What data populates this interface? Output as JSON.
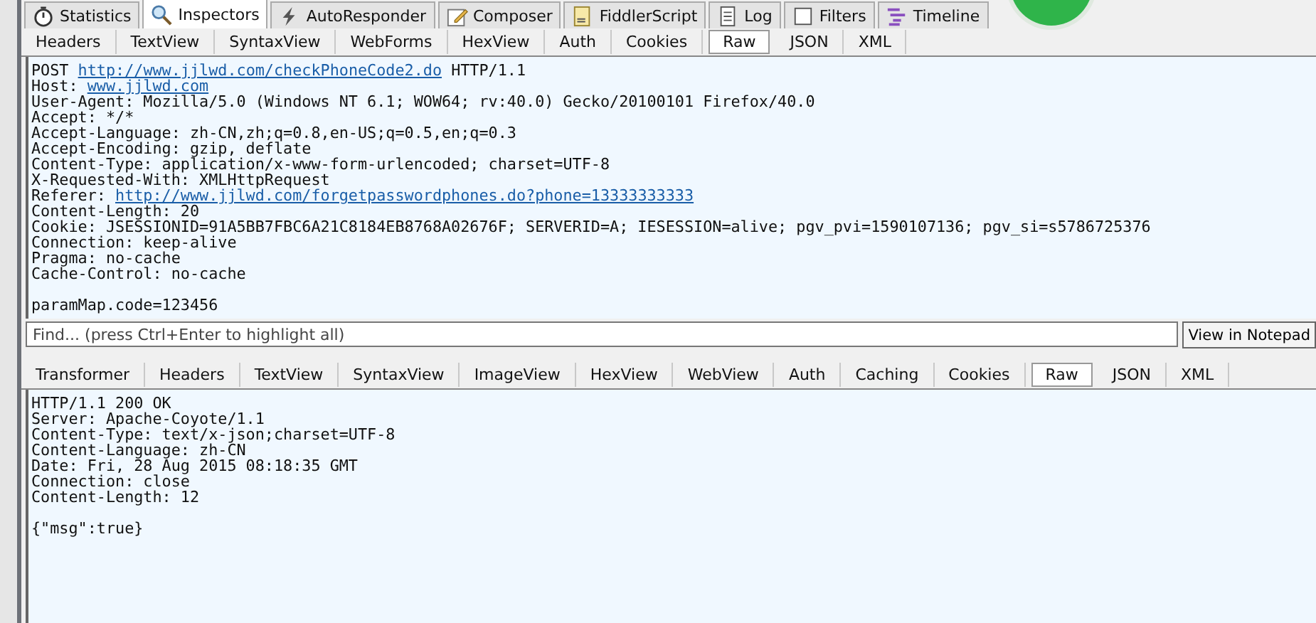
{
  "main_tabs": [
    {
      "label": "Statistics",
      "kind": "stopwatch",
      "selected": false
    },
    {
      "label": "Inspectors",
      "kind": "magnifier",
      "selected": true
    },
    {
      "label": "AutoResponder",
      "kind": "bolt",
      "selected": false
    },
    {
      "label": "Composer",
      "kind": "pencil",
      "selected": false
    },
    {
      "label": "FiddlerScript",
      "kind": "script",
      "selected": false
    },
    {
      "label": "Log",
      "kind": "document",
      "selected": false
    },
    {
      "label": "Filters",
      "kind": "checkbox",
      "selected": false
    },
    {
      "label": "Timeline",
      "kind": "timeline",
      "selected": false
    }
  ],
  "request": {
    "tabs": [
      {
        "label": "Headers",
        "selected": false
      },
      {
        "label": "TextView",
        "selected": false
      },
      {
        "label": "SyntaxView",
        "selected": false
      },
      {
        "label": "WebForms",
        "selected": false
      },
      {
        "label": "HexView",
        "selected": false
      },
      {
        "label": "Auth",
        "selected": false
      },
      {
        "label": "Cookies",
        "selected": false
      },
      {
        "label": "Raw",
        "selected": true
      },
      {
        "label": "JSON",
        "selected": false
      },
      {
        "label": "XML",
        "selected": false
      }
    ],
    "lines": [
      {
        "blank_before": false,
        "parts": [
          {
            "kind": "plain",
            "text": "POST "
          },
          {
            "kind": "link",
            "text": "http://www.jjlwd.com/checkPhoneCode2.do"
          },
          {
            "kind": "plain",
            "text": " HTTP/1.1"
          }
        ]
      },
      {
        "blank_before": false,
        "parts": [
          {
            "kind": "plain",
            "text": "Host: "
          },
          {
            "kind": "link",
            "text": "www.jjlwd.com"
          }
        ]
      },
      {
        "blank_before": false,
        "parts": [
          {
            "kind": "plain",
            "text": "User-Agent: Mozilla/5.0 (Windows NT 6.1; WOW64; rv:40.0) Gecko/20100101 Firefox/40.0"
          }
        ]
      },
      {
        "blank_before": false,
        "parts": [
          {
            "kind": "plain",
            "text": "Accept: */*"
          }
        ]
      },
      {
        "blank_before": false,
        "parts": [
          {
            "kind": "plain",
            "text": "Accept-Language: zh-CN,zh;q=0.8,en-US;q=0.5,en;q=0.3"
          }
        ]
      },
      {
        "blank_before": false,
        "parts": [
          {
            "kind": "plain",
            "text": "Accept-Encoding: gzip, deflate"
          }
        ]
      },
      {
        "blank_before": false,
        "parts": [
          {
            "kind": "plain",
            "text": "Content-Type: application/x-www-form-urlencoded; charset=UTF-8"
          }
        ]
      },
      {
        "blank_before": false,
        "parts": [
          {
            "kind": "plain",
            "text": "X-Requested-With: XMLHttpRequest"
          }
        ]
      },
      {
        "blank_before": false,
        "parts": [
          {
            "kind": "plain",
            "text": "Referer: "
          },
          {
            "kind": "link",
            "text": "http://www.jjlwd.com/forgetpasswordphones.do?phone=13333333333"
          }
        ]
      },
      {
        "blank_before": false,
        "parts": [
          {
            "kind": "plain",
            "text": "Content-Length: 20"
          }
        ]
      },
      {
        "blank_before": false,
        "parts": [
          {
            "kind": "plain",
            "text": "Cookie: JSESSIONID=91A5BB7FBC6A21C8184EB8768A02676F; SERVERID=A; IESESSION=alive; pgv_pvi=1590107136; pgv_si=s5786725376"
          }
        ]
      },
      {
        "blank_before": false,
        "parts": [
          {
            "kind": "plain",
            "text": "Connection: keep-alive"
          }
        ]
      },
      {
        "blank_before": false,
        "parts": [
          {
            "kind": "plain",
            "text": "Pragma: no-cache"
          }
        ]
      },
      {
        "blank_before": false,
        "parts": [
          {
            "kind": "plain",
            "text": "Cache-Control: no-cache"
          }
        ]
      },
      {
        "blank_before": true,
        "parts": [
          {
            "kind": "plain",
            "text": "paramMap.code=123456"
          }
        ]
      }
    ],
    "find": {
      "placeholder": "Find... (press Ctrl+Enter to highlight all)"
    },
    "notepad_button": "View in Notepad"
  },
  "response": {
    "tabs": [
      {
        "label": "Transformer",
        "selected": false
      },
      {
        "label": "Headers",
        "selected": false
      },
      {
        "label": "TextView",
        "selected": false
      },
      {
        "label": "SyntaxView",
        "selected": false
      },
      {
        "label": "ImageView",
        "selected": false
      },
      {
        "label": "HexView",
        "selected": false
      },
      {
        "label": "WebView",
        "selected": false
      },
      {
        "label": "Auth",
        "selected": false
      },
      {
        "label": "Caching",
        "selected": false
      },
      {
        "label": "Cookies",
        "selected": false
      },
      {
        "label": "Raw",
        "selected": true
      },
      {
        "label": "JSON",
        "selected": false
      },
      {
        "label": "XML",
        "selected": false
      }
    ],
    "lines": [
      {
        "blank_before": false,
        "parts": [
          {
            "kind": "plain",
            "text": "HTTP/1.1 200 OK"
          }
        ]
      },
      {
        "blank_before": false,
        "parts": [
          {
            "kind": "plain",
            "text": "Server: Apache-Coyote/1.1"
          }
        ]
      },
      {
        "blank_before": false,
        "parts": [
          {
            "kind": "plain",
            "text": "Content-Type: text/x-json;charset=UTF-8"
          }
        ]
      },
      {
        "blank_before": false,
        "parts": [
          {
            "kind": "plain",
            "text": "Content-Language: zh-CN"
          }
        ]
      },
      {
        "blank_before": false,
        "parts": [
          {
            "kind": "plain",
            "text": "Date: Fri, 28 Aug 2015 08:18:35 GMT"
          }
        ]
      },
      {
        "blank_before": false,
        "parts": [
          {
            "kind": "plain",
            "text": "Connection: close"
          }
        ]
      },
      {
        "blank_before": false,
        "parts": [
          {
            "kind": "plain",
            "text": "Content-Length: 12"
          }
        ]
      },
      {
        "blank_before": true,
        "parts": [
          {
            "kind": "plain",
            "text": "{\"msg\":true}"
          }
        ]
      }
    ]
  }
}
